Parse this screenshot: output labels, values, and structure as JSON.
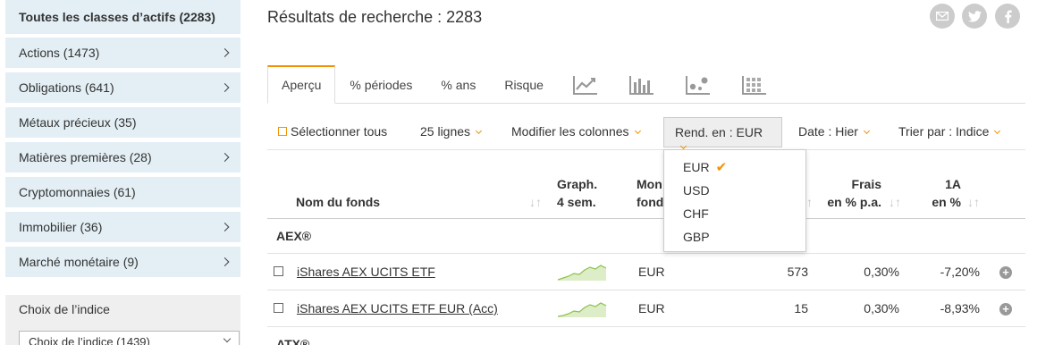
{
  "sidebar": {
    "items": [
      {
        "label": "Toutes les classes d’actifs (2283)",
        "chevron": false
      },
      {
        "label": "Actions (1473)",
        "chevron": true
      },
      {
        "label": "Obligations (641)",
        "chevron": true
      },
      {
        "label": "Métaux précieux (35)",
        "chevron": false
      },
      {
        "label": "Matières premières (28)",
        "chevron": true
      },
      {
        "label": "Cryptomonnaies (61)",
        "chevron": false
      },
      {
        "label": "Immobilier (36)",
        "chevron": true
      },
      {
        "label": "Marché monétaire (9)",
        "chevron": true
      }
    ],
    "index_box": {
      "title": "Choix de l’indice",
      "select_value": "Choix de l’indice (1439)"
    }
  },
  "main": {
    "title": "Résultats de recherche : 2283",
    "tabs": [
      "Aperçu",
      "% périodes",
      "% ans",
      "Risque"
    ],
    "toolbar": {
      "select_all": "Sélectionner tous",
      "lines": "25 lignes",
      "columns": "Modifier les colonnes",
      "currency": "Rend. en : EUR",
      "date": "Date : Hier",
      "sort": "Trier par : Indice"
    },
    "currency_dropdown": {
      "options": [
        "EUR",
        "USD",
        "CHF",
        "GBP"
      ],
      "selected": "EUR"
    },
    "table": {
      "headers": {
        "name": "Nom du fonds",
        "graph1": "Graph.",
        "graph2": "4 sem.",
        "cur1": "Mon",
        "cur2": "fond",
        "fees1": "Frais",
        "fees2": "en % p.a.",
        "y1": "1A",
        "y2": "en %"
      },
      "groups": [
        {
          "name": "AEX®",
          "rows": [
            {
              "name": "iShares AEX UCITS ETF",
              "currency": "EUR",
              "size": "573",
              "fees": "0,30%",
              "perf": "-7,20%"
            },
            {
              "name": "iShares AEX UCITS ETF EUR (Acc)",
              "currency": "EUR",
              "size": "15",
              "fees": "0,30%",
              "perf": "-8,93%"
            }
          ]
        },
        {
          "name": "ATX®",
          "rows": []
        }
      ]
    }
  },
  "colors": {
    "accent": "#f39200",
    "sidebar_bg": "#e3eff5",
    "spark_line": "#8bc34a"
  }
}
